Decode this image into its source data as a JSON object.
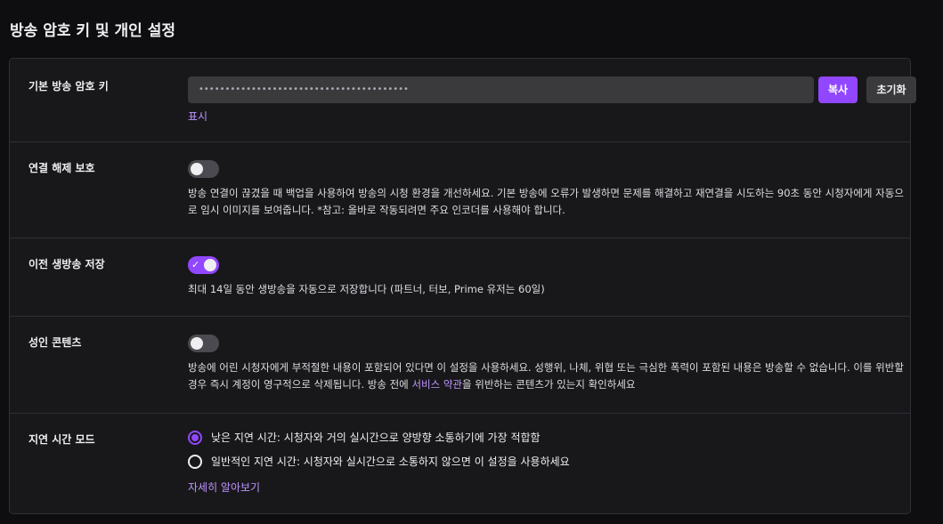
{
  "page": {
    "title": "방송 암호 키 및 개인 설정"
  },
  "stream_key": {
    "label": "기본 방송 암호 키",
    "value": "••••••••••••••••••••••••••••••••••••••••",
    "copy_label": "복사",
    "reset_label": "초기화",
    "show_label": "표시"
  },
  "disconnect_protection": {
    "label": "연결 해제 보호",
    "enabled": false,
    "desc": "방송 연결이 끊겼을 때 백업을 사용하여 방송의 시청 환경을 개선하세요. 기본 방송에 오류가 발생하면 문제를 해결하고 재연결을 시도하는 90초 동안 시청자에게 자동으로 임시 이미지를 보여줍니다. *참고: 올바로 작동되려면 주요 인코더를 사용해야 합니다."
  },
  "store_past": {
    "label": "이전 생방송 저장",
    "enabled": true,
    "desc": "최대 14일 동안 생방송을 자동으로 저장합니다 (파트너, 터보, Prime 유저는 60일)"
  },
  "mature": {
    "label": "성인 콘텐츠",
    "enabled": false,
    "desc_1": "방송에 어린 시청자에게 부적절한 내용이 포함되어 있다면 이 설정을 사용하세요. 성행위, 나체, 위협 또는 극심한 폭력이 포함된 내용은 방송할 수 없습니다. 이를 위반할 경우 즉시 계정이 영구적으로 삭제됩니다. 방송 전에 ",
    "desc_link": "서비스 약관",
    "desc_2": "을 위반하는 콘텐츠가 있는지 확인하세요"
  },
  "latency": {
    "label": "지연 시간 모드",
    "options": [
      {
        "label": "낮은 지연 시간: 시청자와 거의 실시간으로 양방향 소통하기에 가장 적합함",
        "selected": true
      },
      {
        "label": "일반적인 지연 시간: 시청자와 실시간으로 소통하지 않으면 이 설정을 사용하세요",
        "selected": false
      }
    ],
    "learn_more": "자세히 알아보기"
  },
  "colors": {
    "accent": "#9147ff",
    "link": "#bf94ff",
    "background": "#0e0e10",
    "panel": "#18181b"
  }
}
